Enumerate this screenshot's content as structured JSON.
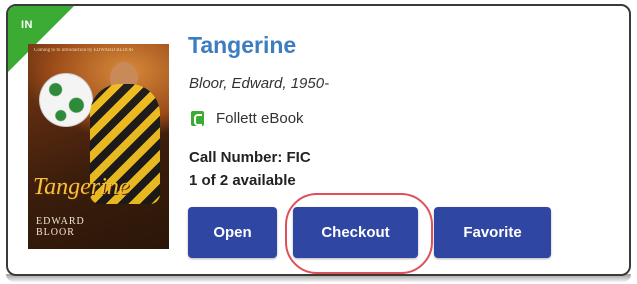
{
  "status_ribbon": {
    "label": "IN",
    "color": "#3bab33"
  },
  "cover": {
    "tagline": "Coming to to introduction by EDWARD BLOOR",
    "title": "Tangerine",
    "author_line1": "EDWARD",
    "author_line2": "BLOOR"
  },
  "book": {
    "title": "Tangerine",
    "author": "Bloor, Edward, 1950-",
    "format": {
      "icon": "ebook-icon",
      "label": "Follett eBook"
    },
    "call_number": "Call Number: FIC",
    "availability": "1 of 2 available"
  },
  "actions": {
    "open_label": "Open",
    "checkout_label": "Checkout",
    "favorite_label": "Favorite",
    "button_color": "#2f46a3"
  },
  "highlight": {
    "target": "checkout-button",
    "color": "#e0505a"
  },
  "colors": {
    "title_link": "#3c7dc1"
  }
}
